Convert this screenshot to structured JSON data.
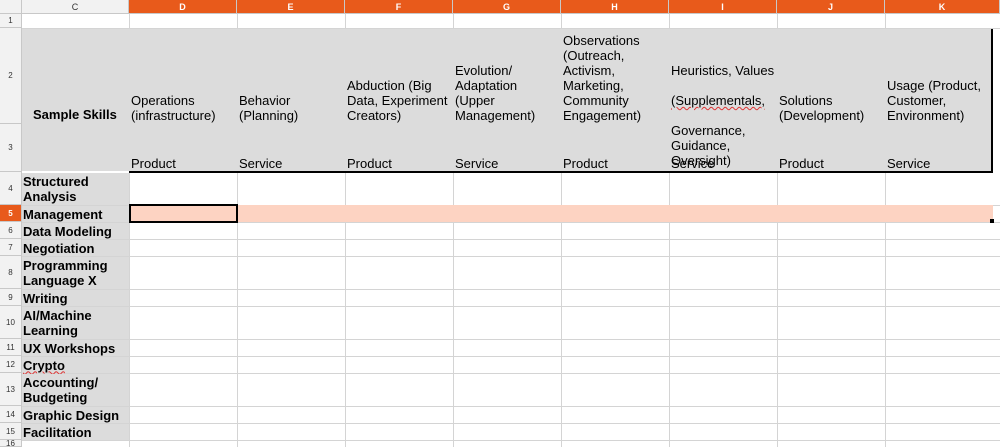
{
  "columns": [
    {
      "id": "C",
      "label": "C"
    },
    {
      "id": "D",
      "label": "D"
    },
    {
      "id": "E",
      "label": "E"
    },
    {
      "id": "F",
      "label": "F"
    },
    {
      "id": "G",
      "label": "G"
    },
    {
      "id": "H",
      "label": "H"
    },
    {
      "id": "I",
      "label": "I"
    },
    {
      "id": "J",
      "label": "J"
    },
    {
      "id": "K",
      "label": "K"
    }
  ],
  "rows": [
    "1",
    "2",
    "3",
    "4",
    "5",
    "6",
    "7",
    "8",
    "9",
    "10",
    "11",
    "12",
    "13",
    "14",
    "15",
    "16"
  ],
  "header": {
    "sample_skills": "Sample Skills",
    "d": {
      "title": "Operations\n(infrastructure)",
      "kind": "Product"
    },
    "e": {
      "title": "Behavior\n(Planning)",
      "kind": "Service"
    },
    "f": {
      "title": "Abduction (Big\nData, Experiment\nCreators)",
      "kind": "Product"
    },
    "g": {
      "title": "Evolution/\nAdaptation\n(Upper\nManagement)",
      "kind": "Service"
    },
    "h": {
      "title": "Observations\n(Outreach,\nActivism,\nMarketing,\nCommunity\nEngagement)",
      "kind": "Product"
    },
    "i": {
      "title_line1": "Heuristics, Values",
      "title_line2": "(Supplementals,",
      "title_rest": "Governance,\nGuidance,\nOversight)",
      "kind": "Service"
    },
    "j": {
      "title": "Solutions\n(Development)",
      "kind": "Product"
    },
    "k": {
      "title": "Usage (Product,\nCustomer,\nEnvironment)",
      "kind": "Service"
    }
  },
  "skills": [
    {
      "row": "4",
      "label": "Structured\nAnalysis"
    },
    {
      "row": "5",
      "label": "Management"
    },
    {
      "row": "6",
      "label": "Data Modeling"
    },
    {
      "row": "7",
      "label": "Negotiation"
    },
    {
      "row": "8",
      "label": "Programming\nLanguage X"
    },
    {
      "row": "9",
      "label": "Writing"
    },
    {
      "row": "10",
      "label": "AI/Machine\nLearning"
    },
    {
      "row": "11",
      "label": "UX Workshops"
    },
    {
      "row": "12",
      "label": "Crypto"
    },
    {
      "row": "13",
      "label": "Accounting/\nBudgeting"
    },
    {
      "row": "14",
      "label": "Graphic Design"
    },
    {
      "row": "15",
      "label": "Facilitation"
    }
  ],
  "selection": {
    "active_cell": "D5",
    "selected_row": "5"
  },
  "colors": {
    "accent": "#e85a1b",
    "header_band": "#dcdcdc",
    "selected_row": "#fdd3c2"
  }
}
